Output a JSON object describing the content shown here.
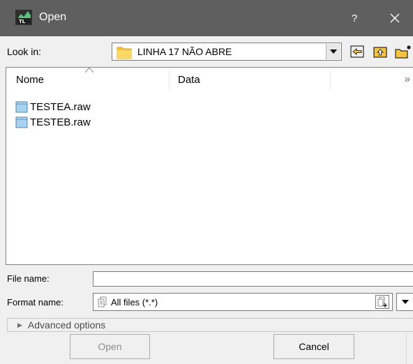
{
  "window": {
    "title": "Open",
    "help_label": "?",
    "close_icon": "close-icon",
    "app_icon": "app-icon"
  },
  "lookin": {
    "label": "Look in:",
    "value": "LINHA 17 NÃO ABRE",
    "folder_icon": "folder-icon"
  },
  "toolbar": {
    "back_icon": "back-arrow-icon",
    "up_icon": "up-folder-icon",
    "new_folder_icon": "new-folder-icon"
  },
  "list": {
    "columns": [
      "Nome",
      "Data"
    ],
    "more_columns": "»",
    "files": [
      {
        "name": "TESTEA.raw",
        "icon": "file-icon"
      },
      {
        "name": "TESTEB.raw",
        "icon": "file-icon"
      }
    ]
  },
  "filename": {
    "label": "File name:",
    "value": ""
  },
  "format": {
    "label": "Format name:",
    "value": "All files (*.*)"
  },
  "advanced": {
    "label": "Advanced options"
  },
  "buttons": {
    "open": "Open",
    "cancel": "Cancel"
  },
  "colors": {
    "titlebar": "#5f5f5f",
    "dialog_bg": "#f0f0f0",
    "folder": "#f5c342"
  }
}
